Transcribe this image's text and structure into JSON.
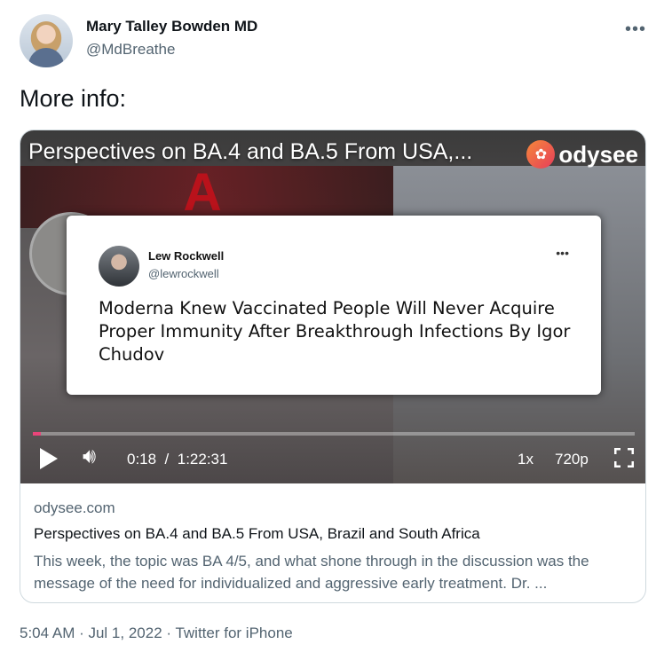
{
  "author": {
    "name": "Mary Talley Bowden MD",
    "handle": "@MdBreathe"
  },
  "more_label": "•••",
  "tweet_text": "More info:",
  "video": {
    "title": "Perspectives on BA.4 and BA.5 From USA,...",
    "platform": "odysee",
    "progress_fraction": 0.014,
    "current_time": "0:18",
    "separator": "/",
    "duration": "1:22:31",
    "speed": "1x",
    "quality": "720p",
    "accent_color": "#e9457a"
  },
  "inner_tweet": {
    "name": "Lew Rockwell",
    "handle": "@lewrockwell",
    "more_label": "•••",
    "headline": "Moderna Knew Vaccinated People Will Never Acquire Proper Immunity After Breakthrough Infections By Igor Chudov"
  },
  "card": {
    "domain": "odysee.com",
    "title": "Perspectives on BA.4 and BA.5 From USA, Brazil and South Africa",
    "description": "This week, the topic was BA 4/5, and what shone through in the discussion was the message of the need for individualized and aggressive early treatment. Dr. ..."
  },
  "timestamp": "5:04 AM · Jul 1, 2022 · Twitter for iPhone"
}
